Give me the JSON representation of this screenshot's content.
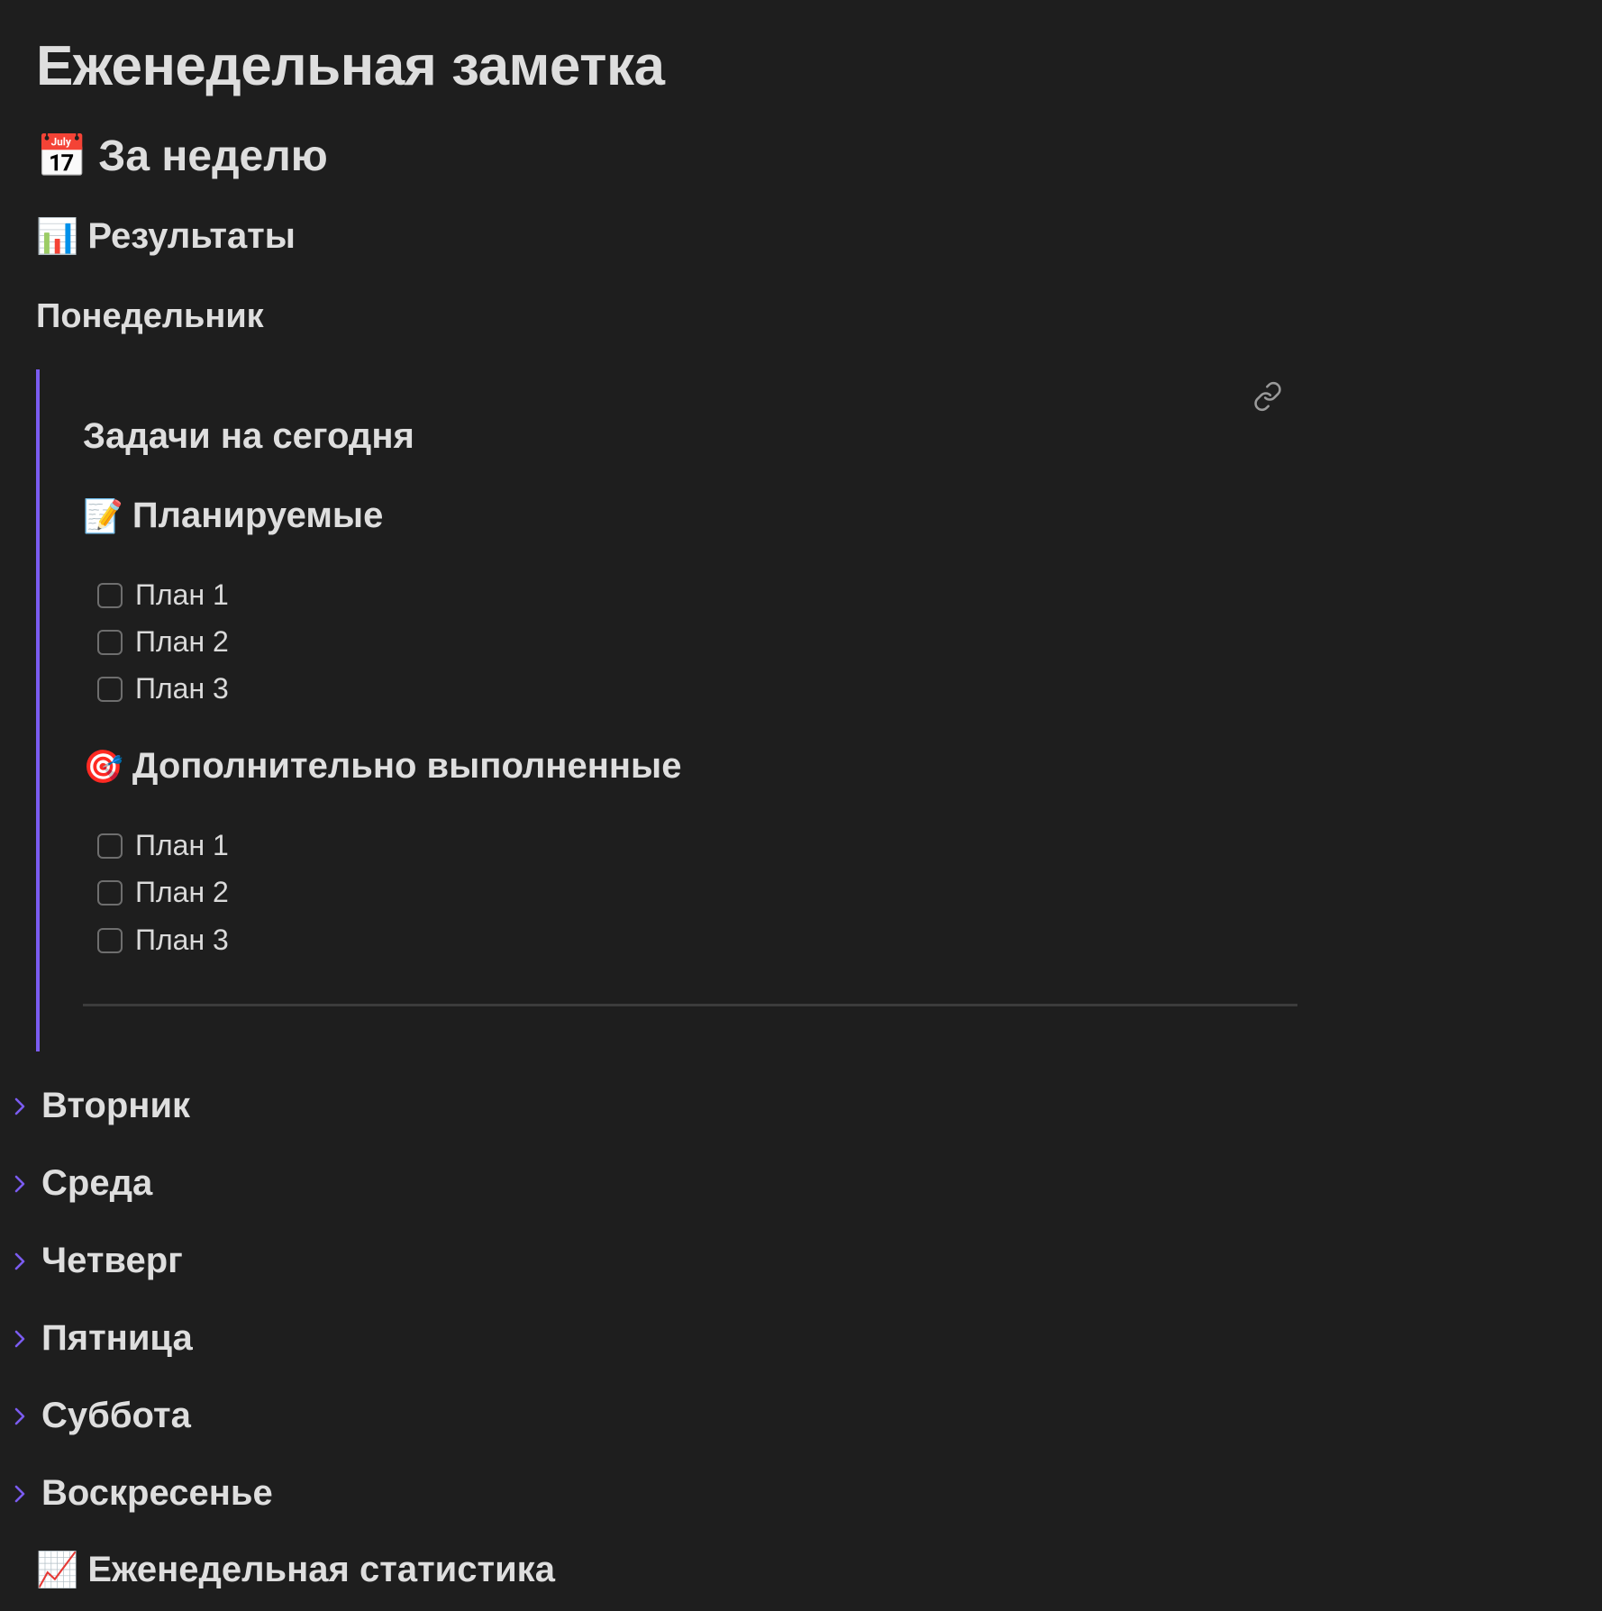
{
  "title": "Еженедельная заметка",
  "week_heading": {
    "emoji": "📅",
    "label": "За неделю"
  },
  "results_heading": {
    "emoji": "📊",
    "label": "Результаты"
  },
  "monday": {
    "label": "Понедельник",
    "embed": {
      "title": "Задачи на сегодня",
      "planned": {
        "emoji": "📝",
        "label": "Планируемые",
        "items": [
          "План 1",
          "План 2",
          "План 3"
        ]
      },
      "extra": {
        "emoji": "🎯",
        "label": "Дополнительно выполненные",
        "items": [
          "План 1",
          "План 2",
          "План 3"
        ]
      }
    }
  },
  "days": [
    "Вторник",
    "Среда",
    "Четверг",
    "Пятница",
    "Суббота",
    "Воскресенье"
  ],
  "stats_heading": {
    "emoji": "📈",
    "label": "Еженедельная статистика"
  },
  "colors": {
    "background": "#1e1e1e",
    "text": "#dedede",
    "accent": "#7b5cf0",
    "divider": "#3c3c3c"
  },
  "icons": {
    "embed_link": "link-icon",
    "fold": "chevron-right-icon"
  }
}
